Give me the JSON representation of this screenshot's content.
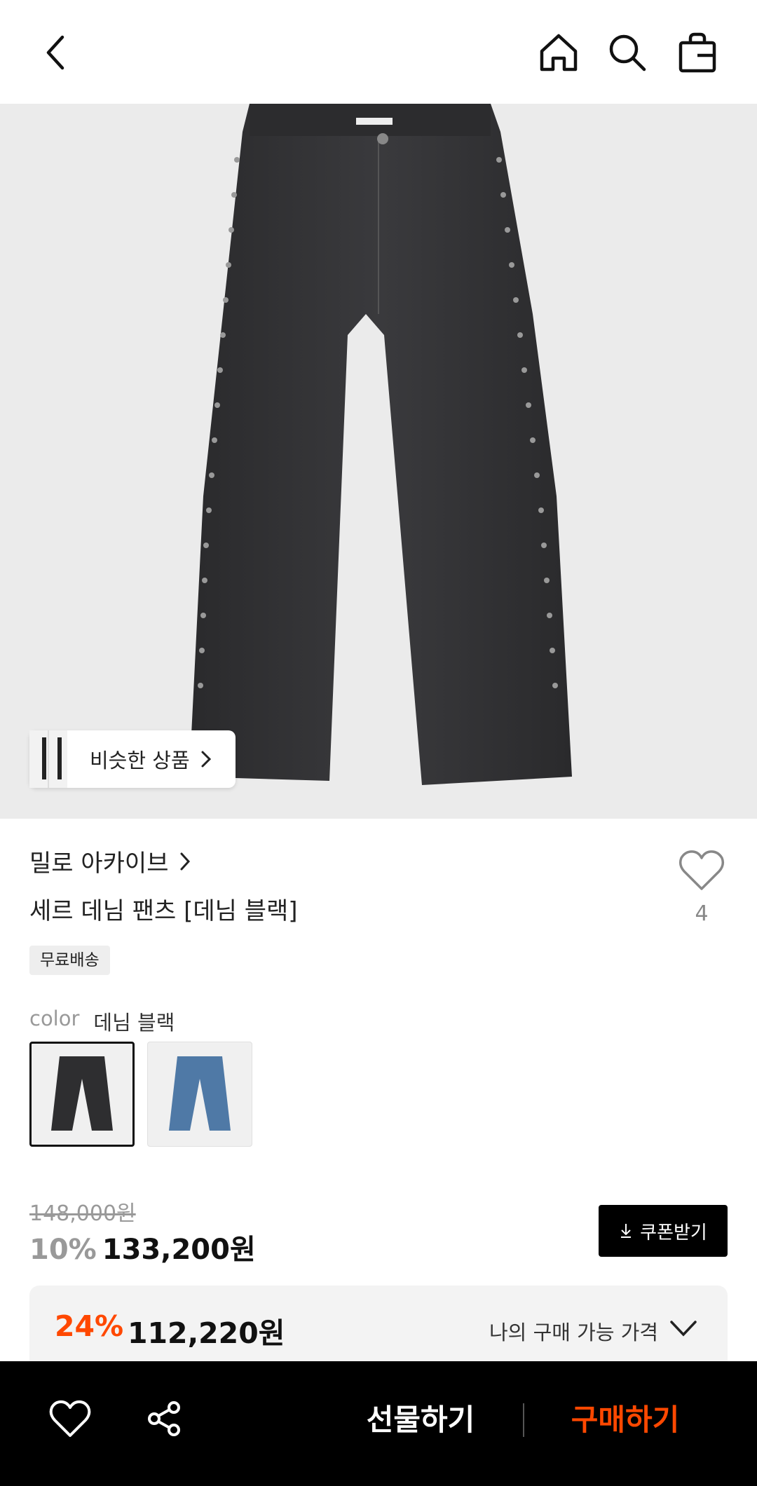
{
  "header": {
    "icons": [
      "chevron-left-icon",
      "home-icon",
      "search-icon",
      "shopping-bag-icon"
    ]
  },
  "hero": {
    "similar_label": "비슷한 상품",
    "background": "#ebebeb"
  },
  "product": {
    "brand": "밀로 아카이브",
    "name": "세르 데님 팬츠 [데님 블랙]",
    "like_count": "4",
    "shipping_badge": "무료배송"
  },
  "options": {
    "color_label": "color",
    "color_value": "데님 블랙",
    "swatches": [
      {
        "name": "데님 블랙",
        "selected": true,
        "color": "#2e2e30"
      },
      {
        "name": "데님 블루",
        "selected": false,
        "color": "#4f79a6"
      }
    ]
  },
  "price": {
    "original": "148,000원",
    "discount_rate": "10%",
    "discount_price": "133,200원",
    "coupon_label": "쿠폰받기"
  },
  "best_price": {
    "rate": "24%",
    "price": "112,220원",
    "label": "나의 구매 가능 가격"
  },
  "bottom_bar": {
    "gift_label": "선물하기",
    "buy_label": "구매하기",
    "accent": "#ff4800"
  }
}
